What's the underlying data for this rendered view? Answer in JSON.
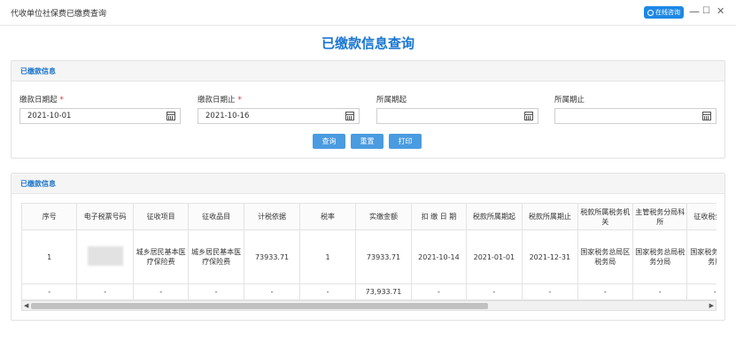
{
  "window": {
    "title": "代收单位社保费已缴费查询",
    "online_label": "在线咨询",
    "minimize": "—",
    "restore": "☐",
    "close": "✕"
  },
  "page_title": "已缴款信息查询",
  "search_panel": {
    "header": "已缴款信息",
    "fields": [
      {
        "label": "缴款日期起",
        "required": "*",
        "value": ""
      },
      {
        "label": "缴款日期止",
        "required": "*",
        "value": ""
      },
      {
        "label": "所属期起",
        "required": "",
        "value": ""
      },
      {
        "label": "所属期止",
        "required": "",
        "value": ""
      }
    ],
    "values": {
      "start": "2021-10-01",
      "end": "2021-10-16"
    },
    "buttons": {
      "query": "查询",
      "reset": "重置",
      "print": "打印"
    }
  },
  "result_panel": {
    "header": "已缴款信息",
    "columns": [
      "序号",
      "电子税票号码",
      "征收项目",
      "征收品目",
      "计税依据",
      "税率",
      "实缴金额",
      "扣 缴 日 期",
      "税款所属期起",
      "税款所属期止",
      "税款所属税务机关",
      "主管税务分局科所",
      "征收税务机关"
    ],
    "row": {
      "no": "1",
      "ticket": "",
      "item": "城乡居民基本医疗保险费",
      "sub_item": "城乡居民基本医疗保险费",
      "basis": "73933.71",
      "rate": "1",
      "amount": "73933.71",
      "deduct_date": "2021-10-14",
      "period_start": "2021-01-01",
      "period_end": "2021-12-31",
      "tax_office": "国家税务总局区税务局",
      "branch": "国家税务总局税务分局",
      "collect_office": "国家税务总局业务股"
    },
    "total": {
      "dash": "-",
      "amount": "73,933.71"
    }
  },
  "scroll": {
    "left": "◀",
    "right": "▶"
  }
}
